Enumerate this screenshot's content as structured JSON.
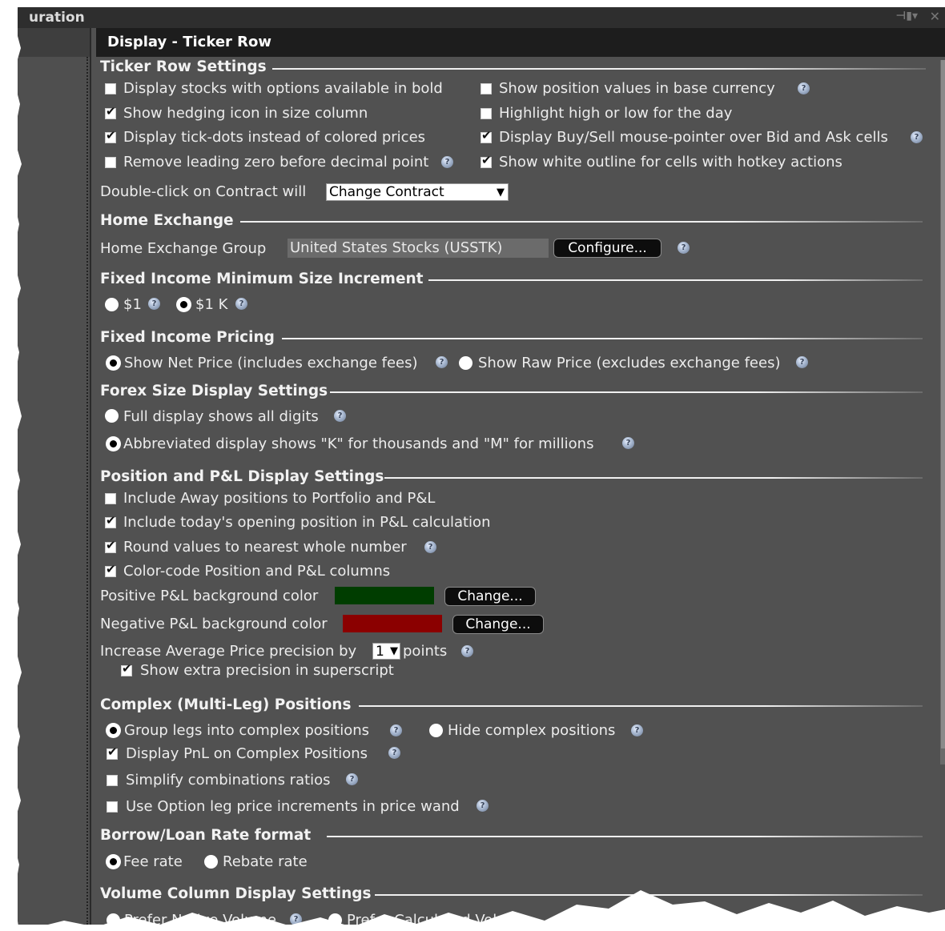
{
  "window": {
    "title": "uration",
    "pin_glyph": "⊣▮▾",
    "close_glyph": "✕"
  },
  "panel": {
    "title": "Display - Ticker Row"
  },
  "ticker_row": {
    "heading": "Ticker Row Settings",
    "opt_bold": "Display stocks with options available in bold",
    "opt_hedging": "Show hedging icon in size column",
    "opt_tickdots": "Display tick-dots instead of colored prices",
    "opt_leading_zero": "Remove leading zero before decimal point",
    "opt_base_currency": "Show position values in base currency",
    "opt_high_low": "Highlight high or low for the day",
    "opt_pointer": "Display Buy/Sell mouse-pointer over Bid and Ask cells",
    "opt_outline": "Show white outline for cells with hotkey actions",
    "double_click_label": "Double-click on Contract will",
    "double_click_value": "Change Contract"
  },
  "home_exchange": {
    "heading": "Home Exchange",
    "group_label": "Home Exchange Group",
    "group_value": "United States Stocks (USSTK)",
    "configure_label": "Configure..."
  },
  "fixed_income_size": {
    "heading": "Fixed Income Minimum Size Increment",
    "opt_1": "$1",
    "opt_1k": "$1 K"
  },
  "fixed_income_pricing": {
    "heading": "Fixed Income Pricing",
    "opt_net": "Show Net Price (includes exchange fees)",
    "opt_raw": "Show Raw Price (excludes exchange fees)"
  },
  "forex": {
    "heading": "Forex Size Display Settings",
    "opt_full": "Full display shows all digits",
    "opt_abbrev": "Abbreviated display shows \"K\" for thousands and \"M\" for millions"
  },
  "position_pl": {
    "heading": "Position and P&L Display Settings",
    "opt_away": "Include Away positions to Portfolio and P&L",
    "opt_opening": "Include today's opening position in P&L calculation",
    "opt_round": "Round values to nearest whole number",
    "opt_colorcode": "Color-code Position and P&L columns",
    "positive_label": "Positive P&L background color",
    "negative_label": "Negative P&L background color",
    "change_label": "Change...",
    "precision_label": "Increase Average Price precision by",
    "precision_value": "1",
    "points_label": "points",
    "superscript_label": "Show extra precision in superscript",
    "positive_color": "#003d00",
    "negative_color": "#8b0000"
  },
  "complex": {
    "heading": "Complex (Multi-Leg) Positions",
    "opt_group": "Group legs into complex positions",
    "opt_hide": "Hide complex positions",
    "opt_pnl": "Display PnL on Complex Positions",
    "opt_simplify": "Simplify combinations ratios",
    "opt_leg_increments": "Use Option leg price increments in price wand"
  },
  "borrow_loan": {
    "heading": "Borrow/Loan Rate format",
    "opt_fee": "Fee rate",
    "opt_rebate": "Rebate rate"
  },
  "volume": {
    "heading": "Volume Column Display Settings",
    "opt_native": "Prefer Native Volume",
    "opt_calculated": "Prefer Calculated Volume"
  },
  "icons": {
    "help": "?"
  }
}
